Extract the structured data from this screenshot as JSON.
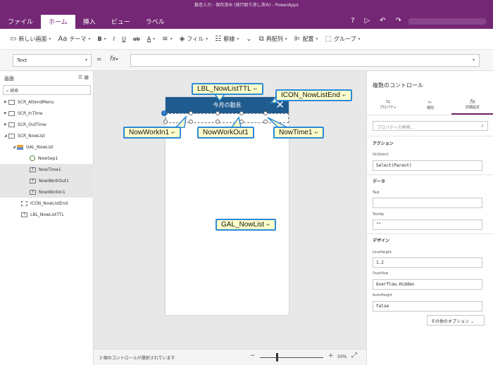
{
  "window": {
    "title": "勤怠入力 - 保存済み (発行取り消し済み) - PowerApps"
  },
  "ribbon_tabs": [
    "ファイル",
    "ホーム",
    "挿入",
    "ビュー",
    "ラベル"
  ],
  "toolbar": {
    "new_screen": "新しい画面",
    "theme": "テーマ",
    "bold": "B",
    "italic": "I",
    "underline": "U",
    "strike": "ab",
    "font_color": "A",
    "fill": "フィル",
    "border": "罫線",
    "reorder": "再配列",
    "align": "配置",
    "group": "グループ"
  },
  "formula_bar": {
    "property": "Text",
    "equals": "=",
    "fx": "fx"
  },
  "tree": {
    "title": "画面",
    "search_placeholder": "検索",
    "items": [
      {
        "label": "SCR_AttendMenu"
      },
      {
        "label": "SCR_InTime"
      },
      {
        "label": "SCR_OutTime"
      },
      {
        "label": "SCR_NowList"
      },
      {
        "label": "GAL_NowList"
      },
      {
        "label": "NowSep1"
      },
      {
        "label": "NowTime1"
      },
      {
        "label": "NowWorkOut1"
      },
      {
        "label": "NowWorkIn1"
      },
      {
        "label": "ICON_NowListEnd"
      },
      {
        "label": "LBL_NowListTTL"
      }
    ]
  },
  "canvas": {
    "header_title": "今月の勤怠",
    "callouts": {
      "lbl": "LBL_NowListTTL",
      "icon": "ICON_NowListEnd",
      "workin": "NowWorkIn1",
      "workout": "NowWorkOut1",
      "time": "NowTime1",
      "gallery": "GAL_NowList"
    },
    "return_mark": "↵"
  },
  "status": {
    "text": "3 個のコントロールが選択されています",
    "zoom": "50%",
    "minus": "−",
    "plus": "+"
  },
  "properties": {
    "title": "複数のコントロール",
    "tabs": [
      "プロパティ",
      "規則",
      "詳細設定"
    ],
    "search_placeholder": "プロパティの検索...",
    "sections": {
      "action": "アクション",
      "data": "データ",
      "design": "デザイン"
    },
    "fields": {
      "onselect_label": "OnSelect",
      "onselect_value": "Select(Parent)",
      "text_label": "Text",
      "text_value": "",
      "tooltip_label": "Tooltip",
      "tooltip_value": "\"\"",
      "lineheight_label": "LineHeight",
      "lineheight_value": "1.2",
      "overflow_label": "Overflow",
      "overflow_value": "Overflow.Hidden",
      "autoheight_label": "AutoHeight",
      "autoheight_value": "false"
    },
    "more_options": "その他のオプション"
  },
  "colors": {
    "brand": "#742774",
    "header": "#1f5b8f",
    "callout_border": "#2b8ad8",
    "callout_fill": "#ffffcc"
  }
}
